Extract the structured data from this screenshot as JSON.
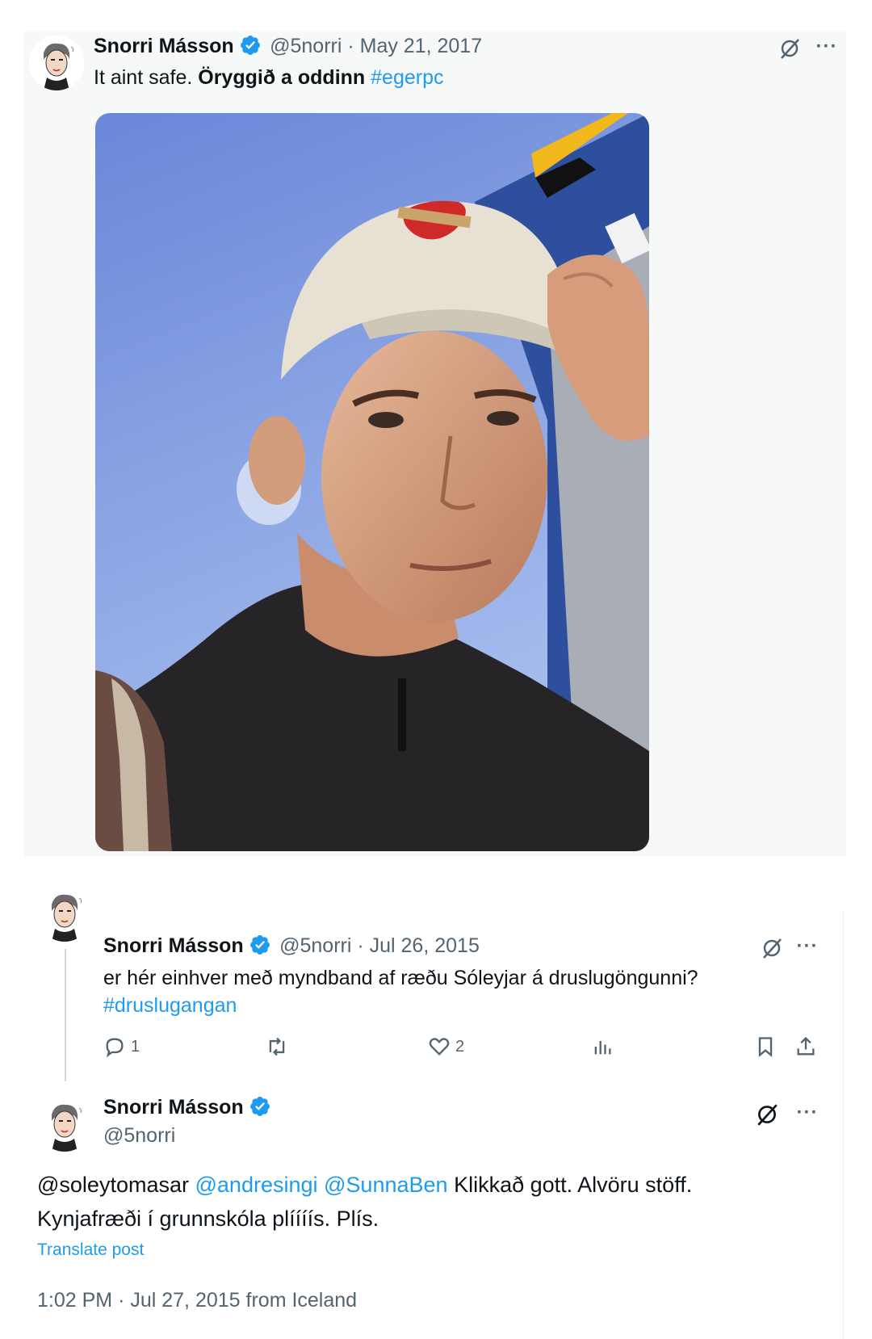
{
  "tweet1": {
    "author_name": "Snorri Másson",
    "handle": "@5norri",
    "date": "May 21, 2017",
    "text_plain": "It aint safe.",
    "text_bold": "Öryggið a oddinn",
    "hashtag": "#egerpc",
    "more_icon": "more-horizontal-icon",
    "grok_icon": "grok-icon"
  },
  "tweet2": {
    "author_name": "Snorri Másson",
    "handle": "@5norri",
    "date": "Jul 26, 2015",
    "text_line1": "er hér einhver með myndband af ræðu Sóleyjar á druslugöngunni?",
    "hashtag": "#druslugangan",
    "actions": {
      "reply_count": "1",
      "like_count": "2"
    }
  },
  "tweet3": {
    "author_name": "Snorri Másson",
    "handle": "@5norri",
    "mention1": "@soleytomasar",
    "mention2": "@andresingi",
    "mention3": "@SunnaBen",
    "text_rest": "Klikkað gott. Alvöru stöff.",
    "text_line2": "Kynjafræði í grunnskóla plíííís. Plís.",
    "translate": "Translate post",
    "time": "1:02 PM",
    "sep": "·",
    "date": "Jul 27, 2015",
    "location": "from Iceland"
  },
  "colors": {
    "link": "#1d9bf0",
    "verified": "#1d9bf0",
    "secondary_text": "#536471"
  }
}
